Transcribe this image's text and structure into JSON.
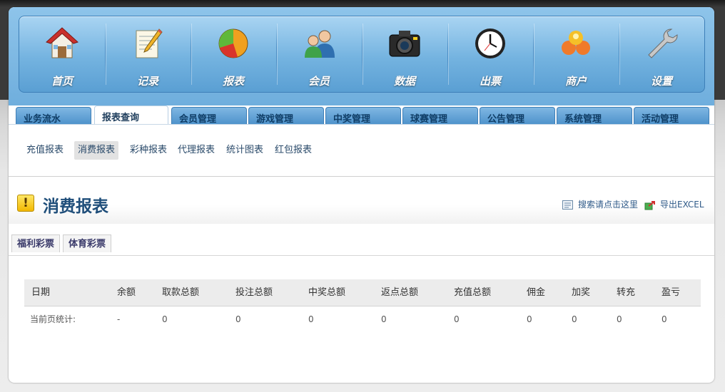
{
  "nav": {
    "items": [
      {
        "label": "首页",
        "icon": "home-icon"
      },
      {
        "label": "记录",
        "icon": "notepad-icon"
      },
      {
        "label": "报表",
        "icon": "pie-chart-icon"
      },
      {
        "label": "会员",
        "icon": "users-icon"
      },
      {
        "label": "数据",
        "icon": "camera-icon"
      },
      {
        "label": "出票",
        "icon": "clock-icon"
      },
      {
        "label": "商户",
        "icon": "merchant-icon"
      },
      {
        "label": "设置",
        "icon": "wrench-icon"
      }
    ]
  },
  "tabs": {
    "items": [
      "业务流水",
      "报表查询",
      "会员管理",
      "游戏管理",
      "中奖管理",
      "球赛管理",
      "公告管理",
      "系统管理",
      "活动管理"
    ],
    "active_index": 1
  },
  "subnav": {
    "items": [
      "充值报表",
      "消费报表",
      "彩种报表",
      "代理报表",
      "统计图表",
      "红包报表"
    ],
    "active_index": 1
  },
  "page": {
    "title": "消费报表",
    "search_label": "搜索请点击这里",
    "export_label": "导出EXCEL"
  },
  "lottery_tabs": [
    "福利彩票",
    "体育彩票"
  ],
  "table": {
    "headers": [
      "日期",
      "余额",
      "取款总额",
      "投注总额",
      "中奖总额",
      "返点总额",
      "充值总额",
      "佣金",
      "加奖",
      "转充",
      "盈亏"
    ],
    "summary_row": [
      "当前页统计:",
      "-",
      "0",
      "0",
      "0",
      "0",
      "0",
      "0",
      "0",
      "0",
      "0"
    ]
  },
  "colors": {
    "nav_gradient_top": "#a9d4f2",
    "nav_gradient_bottom": "#5a9fd3",
    "tab_text": "#0f3d66",
    "title": "#1f4e7a"
  }
}
